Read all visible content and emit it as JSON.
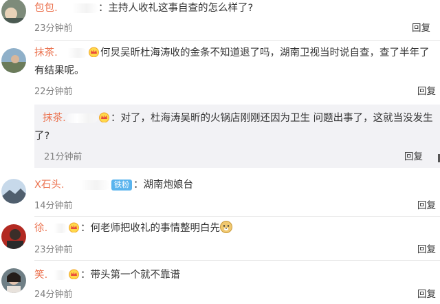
{
  "comments": [
    {
      "user": "包包…",
      "text": "：主持人收礼这事自查的怎么样了?",
      "time": "23分钟前",
      "reply": "回复"
    },
    {
      "user": "抹茶…",
      "text_line1": "何炅吴昕杜海涛收的金条不知道退了吗，湖南卫视当时说自查，查了半年了",
      "text_line2": "有结果呢。",
      "time": "22分钟前",
      "reply": "回复"
    },
    {
      "user": "抹茶…",
      "text_line1": "：对了，杜海涛吴昕的火锅店刚刚还因为卫生 问题出事了，这就当没发生",
      "text_line2": "了?",
      "time": "21分钟前",
      "reply": "回复"
    },
    {
      "user": "X石头…",
      "badge": "铁粉",
      "text": "：湖南炮娘台",
      "time": "14分钟前",
      "reply": "回复"
    },
    {
      "user": "徐…",
      "text": "：何老师把收礼的事情整明白先",
      "time": "23分钟前",
      "reply": "回复"
    },
    {
      "user": "笑…",
      "text": "：带头第一个就不靠谱",
      "time": "24分钟前",
      "reply": "回复"
    }
  ],
  "icons": {
    "crown": "crown-vip-icon",
    "doge": "doge-emoji-icon"
  },
  "colors": {
    "username": "#eb7350",
    "badge": "#5ab4ee",
    "time": "#808080",
    "reply_box": "#f2f2f5"
  }
}
